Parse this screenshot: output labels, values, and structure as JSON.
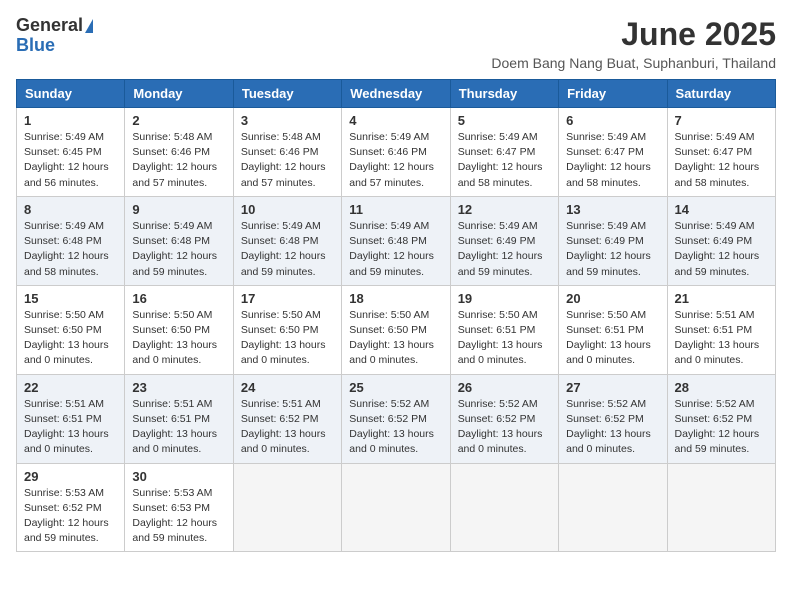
{
  "logo": {
    "general": "General",
    "blue": "Blue"
  },
  "title": "June 2025",
  "location": "Doem Bang Nang Buat, Suphanburi, Thailand",
  "days_of_week": [
    "Sunday",
    "Monday",
    "Tuesday",
    "Wednesday",
    "Thursday",
    "Friday",
    "Saturday"
  ],
  "weeks": [
    [
      {
        "day": "1",
        "sunrise": "5:49 AM",
        "sunset": "6:45 PM",
        "daylight": "12 hours and 56 minutes."
      },
      {
        "day": "2",
        "sunrise": "5:48 AM",
        "sunset": "6:46 PM",
        "daylight": "12 hours and 57 minutes."
      },
      {
        "day": "3",
        "sunrise": "5:48 AM",
        "sunset": "6:46 PM",
        "daylight": "12 hours and 57 minutes."
      },
      {
        "day": "4",
        "sunrise": "5:49 AM",
        "sunset": "6:46 PM",
        "daylight": "12 hours and 57 minutes."
      },
      {
        "day": "5",
        "sunrise": "5:49 AM",
        "sunset": "6:47 PM",
        "daylight": "12 hours and 58 minutes."
      },
      {
        "day": "6",
        "sunrise": "5:49 AM",
        "sunset": "6:47 PM",
        "daylight": "12 hours and 58 minutes."
      },
      {
        "day": "7",
        "sunrise": "5:49 AM",
        "sunset": "6:47 PM",
        "daylight": "12 hours and 58 minutes."
      }
    ],
    [
      {
        "day": "8",
        "sunrise": "5:49 AM",
        "sunset": "6:48 PM",
        "daylight": "12 hours and 58 minutes."
      },
      {
        "day": "9",
        "sunrise": "5:49 AM",
        "sunset": "6:48 PM",
        "daylight": "12 hours and 59 minutes."
      },
      {
        "day": "10",
        "sunrise": "5:49 AM",
        "sunset": "6:48 PM",
        "daylight": "12 hours and 59 minutes."
      },
      {
        "day": "11",
        "sunrise": "5:49 AM",
        "sunset": "6:48 PM",
        "daylight": "12 hours and 59 minutes."
      },
      {
        "day": "12",
        "sunrise": "5:49 AM",
        "sunset": "6:49 PM",
        "daylight": "12 hours and 59 minutes."
      },
      {
        "day": "13",
        "sunrise": "5:49 AM",
        "sunset": "6:49 PM",
        "daylight": "12 hours and 59 minutes."
      },
      {
        "day": "14",
        "sunrise": "5:49 AM",
        "sunset": "6:49 PM",
        "daylight": "12 hours and 59 minutes."
      }
    ],
    [
      {
        "day": "15",
        "sunrise": "5:50 AM",
        "sunset": "6:50 PM",
        "daylight": "13 hours and 0 minutes."
      },
      {
        "day": "16",
        "sunrise": "5:50 AM",
        "sunset": "6:50 PM",
        "daylight": "13 hours and 0 minutes."
      },
      {
        "day": "17",
        "sunrise": "5:50 AM",
        "sunset": "6:50 PM",
        "daylight": "13 hours and 0 minutes."
      },
      {
        "day": "18",
        "sunrise": "5:50 AM",
        "sunset": "6:50 PM",
        "daylight": "13 hours and 0 minutes."
      },
      {
        "day": "19",
        "sunrise": "5:50 AM",
        "sunset": "6:51 PM",
        "daylight": "13 hours and 0 minutes."
      },
      {
        "day": "20",
        "sunrise": "5:50 AM",
        "sunset": "6:51 PM",
        "daylight": "13 hours and 0 minutes."
      },
      {
        "day": "21",
        "sunrise": "5:51 AM",
        "sunset": "6:51 PM",
        "daylight": "13 hours and 0 minutes."
      }
    ],
    [
      {
        "day": "22",
        "sunrise": "5:51 AM",
        "sunset": "6:51 PM",
        "daylight": "13 hours and 0 minutes."
      },
      {
        "day": "23",
        "sunrise": "5:51 AM",
        "sunset": "6:51 PM",
        "daylight": "13 hours and 0 minutes."
      },
      {
        "day": "24",
        "sunrise": "5:51 AM",
        "sunset": "6:52 PM",
        "daylight": "13 hours and 0 minutes."
      },
      {
        "day": "25",
        "sunrise": "5:52 AM",
        "sunset": "6:52 PM",
        "daylight": "13 hours and 0 minutes."
      },
      {
        "day": "26",
        "sunrise": "5:52 AM",
        "sunset": "6:52 PM",
        "daylight": "13 hours and 0 minutes."
      },
      {
        "day": "27",
        "sunrise": "5:52 AM",
        "sunset": "6:52 PM",
        "daylight": "13 hours and 0 minutes."
      },
      {
        "day": "28",
        "sunrise": "5:52 AM",
        "sunset": "6:52 PM",
        "daylight": "12 hours and 59 minutes."
      }
    ],
    [
      {
        "day": "29",
        "sunrise": "5:53 AM",
        "sunset": "6:52 PM",
        "daylight": "12 hours and 59 minutes."
      },
      {
        "day": "30",
        "sunrise": "5:53 AM",
        "sunset": "6:53 PM",
        "daylight": "12 hours and 59 minutes."
      },
      null,
      null,
      null,
      null,
      null
    ]
  ]
}
